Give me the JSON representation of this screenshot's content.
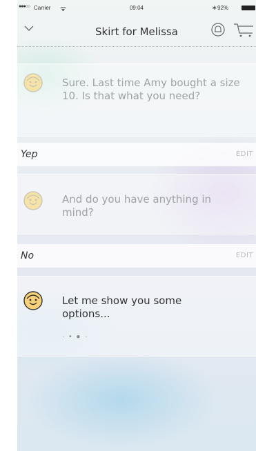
{
  "status_bar": {
    "signal": "●●●○○",
    "carrier": "Carrier",
    "wifi": "ᯤ",
    "time": "09:04",
    "bluetooth": "∗",
    "battery": "92%"
  },
  "nav": {
    "title": "Skirt for Melissa",
    "back_icon": "chevron-down-icon",
    "bell_icon": "bell-icon",
    "cart_icon": "cart-icon"
  },
  "conversation": [
    {
      "type": "bot",
      "text": "Sure. Last time Amy bought a size 10. Is that what you need?"
    },
    {
      "type": "answer",
      "text": "Yep",
      "edit_label": "EDIT"
    },
    {
      "type": "bot",
      "text": "And do you have anything in mind?"
    },
    {
      "type": "answer",
      "text": "No",
      "edit_label": "EDIT"
    },
    {
      "type": "bot",
      "text": "Let me show you some options...",
      "typing_indicator": "· • ● ·"
    }
  ],
  "colors": {
    "text_faded": "#9ea3a6",
    "text_active": "#333333",
    "avatar_face": "#f8d27a",
    "avatar_face_faded": "#f6e3a8"
  }
}
